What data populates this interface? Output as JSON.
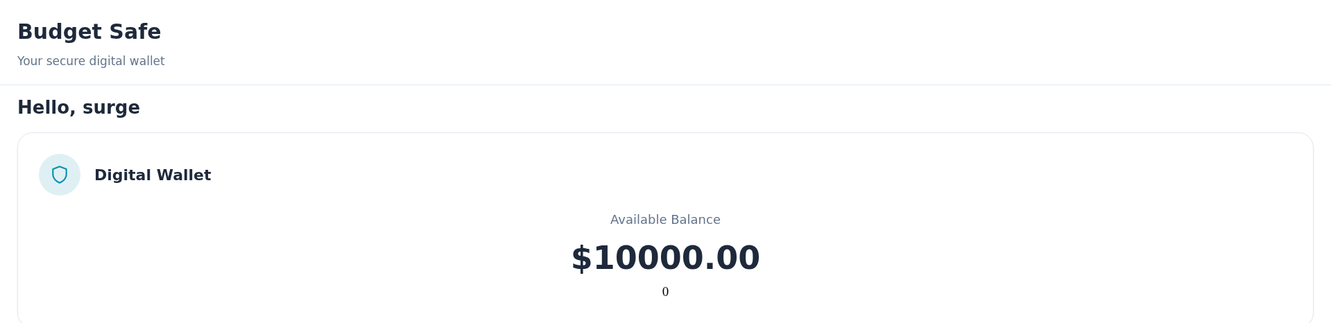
{
  "header": {
    "title": "Budget Safe",
    "subtitle": "Your secure digital wallet"
  },
  "greeting": "Hello, surge",
  "wallet": {
    "title": "Digital Wallet",
    "balance_label": "Available Balance",
    "balance": "$10000.00",
    "note": "0"
  }
}
